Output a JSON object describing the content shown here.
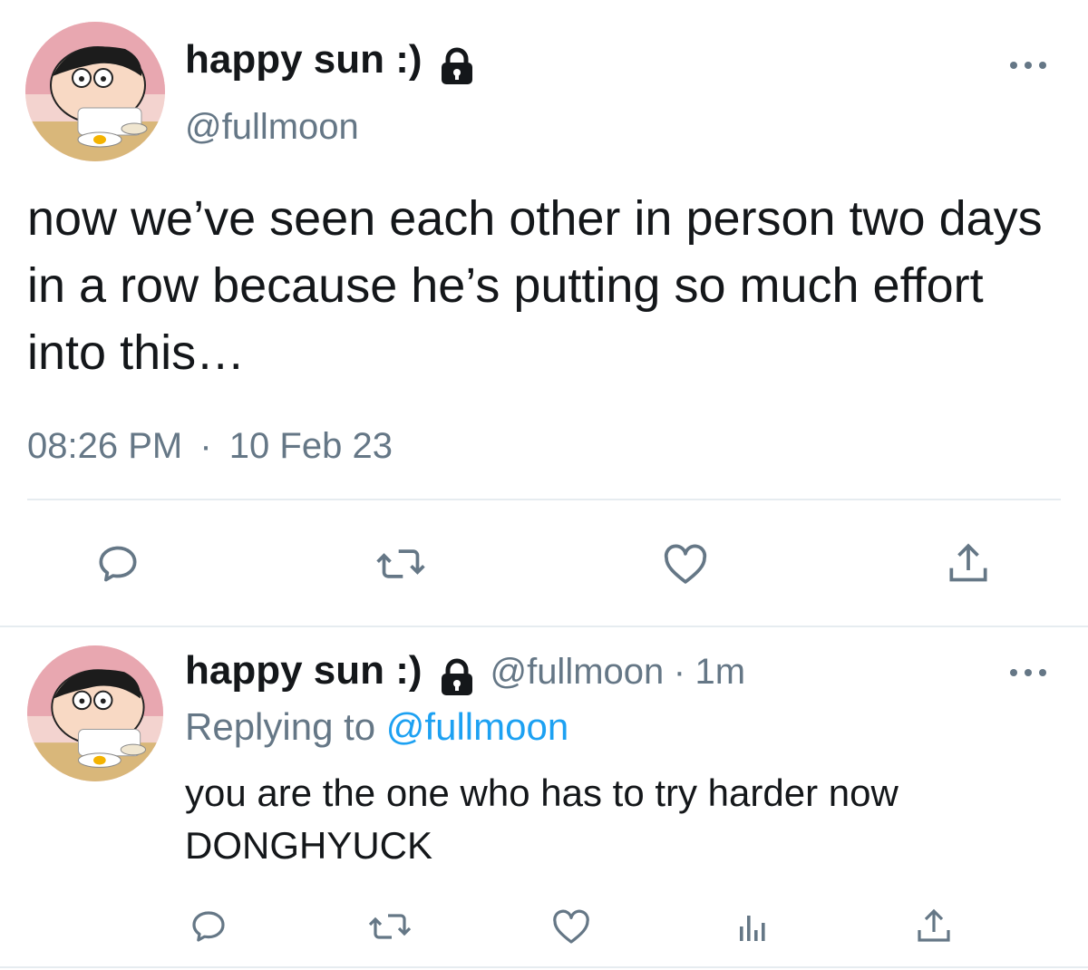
{
  "tweet": {
    "display_name": "happy sun :)",
    "handle": "@fullmoon",
    "text": "now we’ve seen each other in person two days in a row because he’s putting so much effort into this…",
    "time": "08:26 PM",
    "separator": "·",
    "date": "10 Feb 23",
    "icons": {
      "lock": "lock-icon",
      "more": "more-icon",
      "reply": "reply-icon",
      "retweet": "retweet-icon",
      "like": "heart-icon",
      "share": "share-icon"
    }
  },
  "reply": {
    "display_name": "happy sun :)",
    "handle": "@fullmoon",
    "separator": "·",
    "age": "1m",
    "replying_prefix": "Replying to",
    "replying_handle": "@fullmoon",
    "text": "you are the one who has to try harder now DONGHYUCK",
    "icons": {
      "lock": "lock-icon",
      "more": "more-icon",
      "reply": "reply-icon",
      "retweet": "retweet-icon",
      "like": "heart-icon",
      "analytics": "analytics-icon",
      "share": "share-icon"
    }
  },
  "colors": {
    "text": "#14171a",
    "muted": "#657786",
    "link": "#1da1f2",
    "divider": "#e6ecf0"
  }
}
